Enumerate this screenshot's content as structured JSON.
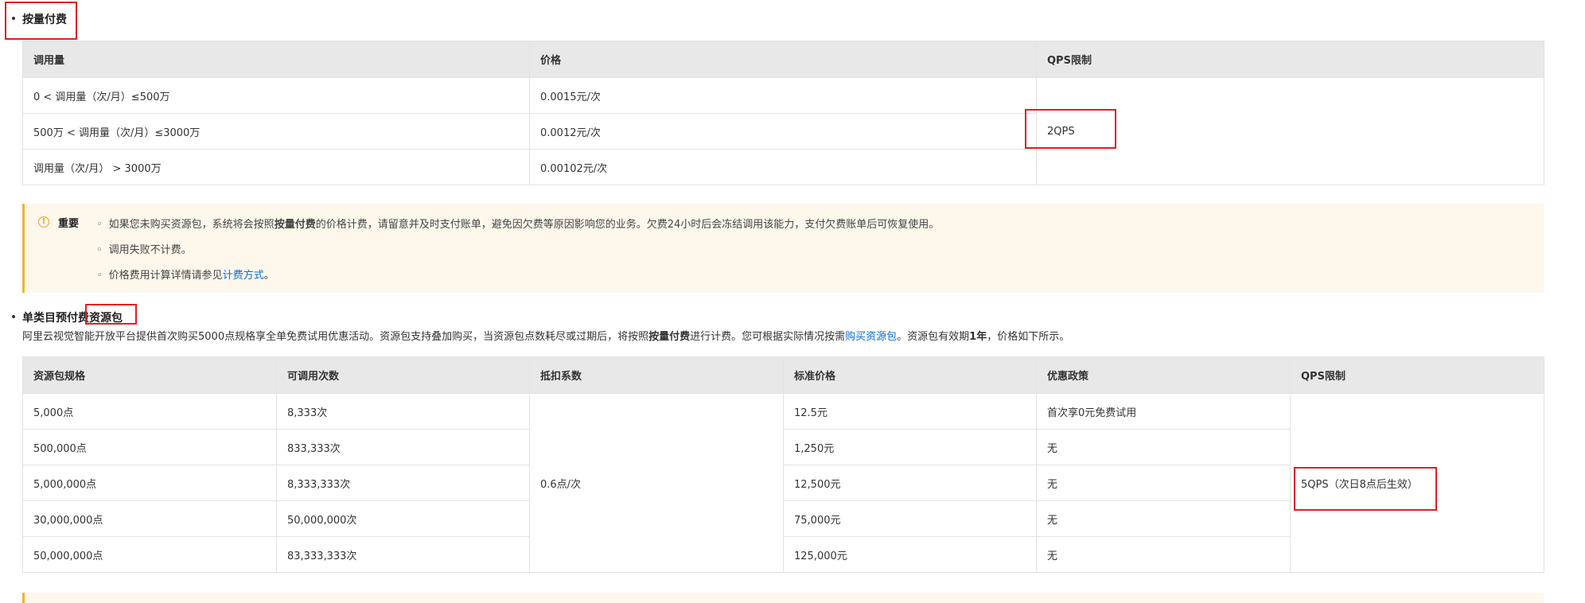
{
  "section1": {
    "title": "按量付费",
    "table": {
      "headers": [
        "调用量",
        "价格",
        "QPS限制"
      ],
      "rows": [
        [
          "0 < 调用量（次/月）≤500万",
          "0.0015元/次"
        ],
        [
          "500万 < 调用量（次/月）≤3000万",
          "0.0012元/次"
        ],
        [
          "调用量（次/月） > 3000万",
          "0.00102元/次"
        ]
      ],
      "qps": "2QPS"
    }
  },
  "notice": {
    "label": "重要",
    "item1_pre": "如果您未购买资源包，系统将会按照",
    "item1_bold": "按量付费",
    "item1_post": "的价格计费，请留意并及时支付账单，避免因欠费等原因影响您的业务。欠费24小时后会冻结调用该能力，支付欠费账单后可恢复使用。",
    "item2": "调用失败不计费。",
    "item3_pre": "价格费用计算详情请参见",
    "item3_link": "计费方式",
    "item3_post": "。"
  },
  "section2": {
    "title": "单类目预付费资源包",
    "intro_pre": "阿里云视觉智能开放平台提供首次购买5000点规格享全单免费试用优惠活动。资源包支持叠加购买，当资源包点数耗尽或过期后，将按照",
    "intro_bold1": "按量付费",
    "intro_mid": "进行计费。您可根据实际情况按需",
    "intro_link": "购买资源包",
    "intro_mid2": "。资源包有效期",
    "intro_bold2": "1年",
    "intro_post": "，价格如下所示。",
    "table": {
      "headers": [
        "资源包规格",
        "可调用次数",
        "抵扣系数",
        "标准价格",
        "优惠政策",
        "QPS限制"
      ],
      "rows": [
        [
          "5,000点",
          "8,333次",
          "12.5元",
          "首次享0元免费试用"
        ],
        [
          "500,000点",
          "833,333次",
          "1,250元",
          "无"
        ],
        [
          "5,000,000点",
          "8,333,333次",
          "12,500元",
          "无"
        ],
        [
          "30,000,000点",
          "50,000,000次",
          "75,000元",
          "无"
        ],
        [
          "50,000,000点",
          "83,333,333次",
          "125,000元",
          "无"
        ]
      ],
      "coefficient": "0.6点/次",
      "qps": "5QPS（次日8点后生效）"
    }
  },
  "colors": {
    "highlight_box": "#e02020",
    "link": "#0a6de0",
    "notice_bg": "#fdf7ec",
    "notice_accent": "#f3b233",
    "header_bg": "#e8e8e8"
  }
}
